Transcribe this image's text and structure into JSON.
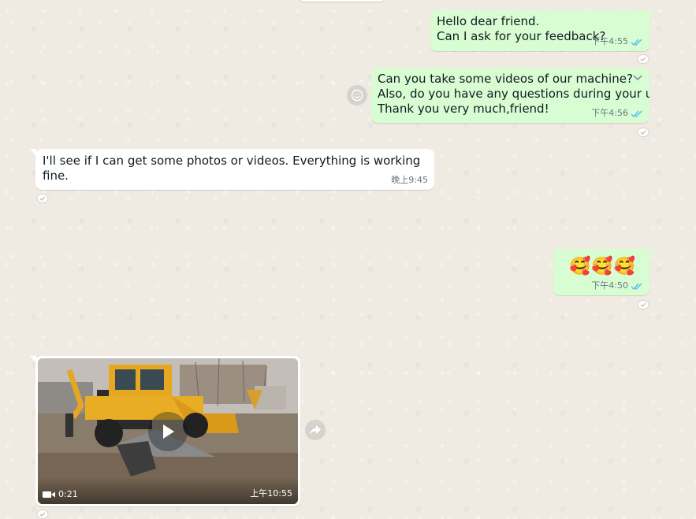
{
  "messages": [
    {
      "id": "m1",
      "direction": "outgoing",
      "text": "Hello dear friend.\nCan I ask for your feedback?",
      "time": "下午4:55",
      "status": "read"
    },
    {
      "id": "m2",
      "direction": "outgoing",
      "text": "Can you take some videos of our machine?\nAlso, do you have any questions during your use?\nThank you very much,friend!",
      "time": "下午4:56",
      "status": "read"
    },
    {
      "id": "m3",
      "direction": "incoming",
      "text": "I'll see if I can get some photos or videos. Everything is working fine.",
      "time": "晚上9:45"
    },
    {
      "id": "m4",
      "direction": "outgoing",
      "text": "🥰🥰🥰",
      "time": "下午4:50",
      "status": "read"
    },
    {
      "id": "m5",
      "direction": "incoming",
      "type": "video",
      "duration": "0:21",
      "time": "上午10:55"
    }
  ],
  "colors": {
    "outgoing_bubble": "#d9fdd3",
    "incoming_bubble": "#ffffff",
    "read_ticks": "#53bdeb",
    "meta_text": "#667781",
    "wallpaper": "#efeae2"
  },
  "icons": {
    "read_ticks": "double-check-icon",
    "reaction": "add-reaction-icon",
    "emoji": "smiley-icon",
    "menu": "chevron-down-icon",
    "forward": "forward-icon",
    "play": "play-icon",
    "video": "video-camera-icon"
  }
}
